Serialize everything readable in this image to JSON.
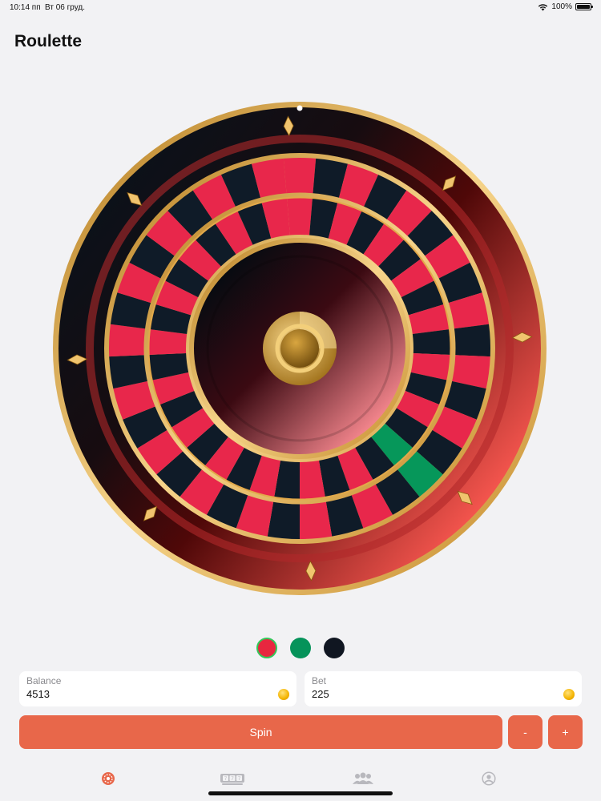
{
  "status_bar": {
    "time": "10:14 пп",
    "date": "Вт 06 груд.",
    "battery": "100%"
  },
  "title": "Roulette",
  "wheel": {
    "pockets": 37,
    "colors": {
      "red": "#e8274b",
      "black": "#0f1b28",
      "green": "#06975a",
      "gold": "#e2a94a"
    }
  },
  "color_options": [
    {
      "name": "red",
      "color": "#e8273f",
      "selected": true
    },
    {
      "name": "green",
      "color": "#06935a",
      "selected": false
    },
    {
      "name": "black",
      "color": "#101621",
      "selected": false
    }
  ],
  "balance": {
    "label": "Balance",
    "value": "4513"
  },
  "bet": {
    "label": "Bet",
    "value": "225"
  },
  "buttons": {
    "spin": "Spin",
    "minus": "-",
    "plus": "+"
  },
  "tabs": [
    {
      "name": "roulette-tab",
      "icon": "roulette-icon",
      "active": true
    },
    {
      "name": "slots-tab",
      "icon": "slot-machine-icon",
      "active": false
    },
    {
      "name": "players-tab",
      "icon": "group-icon",
      "active": false
    },
    {
      "name": "profile-tab",
      "icon": "person-circle-icon",
      "active": false
    }
  ],
  "accent": "#e8674a"
}
